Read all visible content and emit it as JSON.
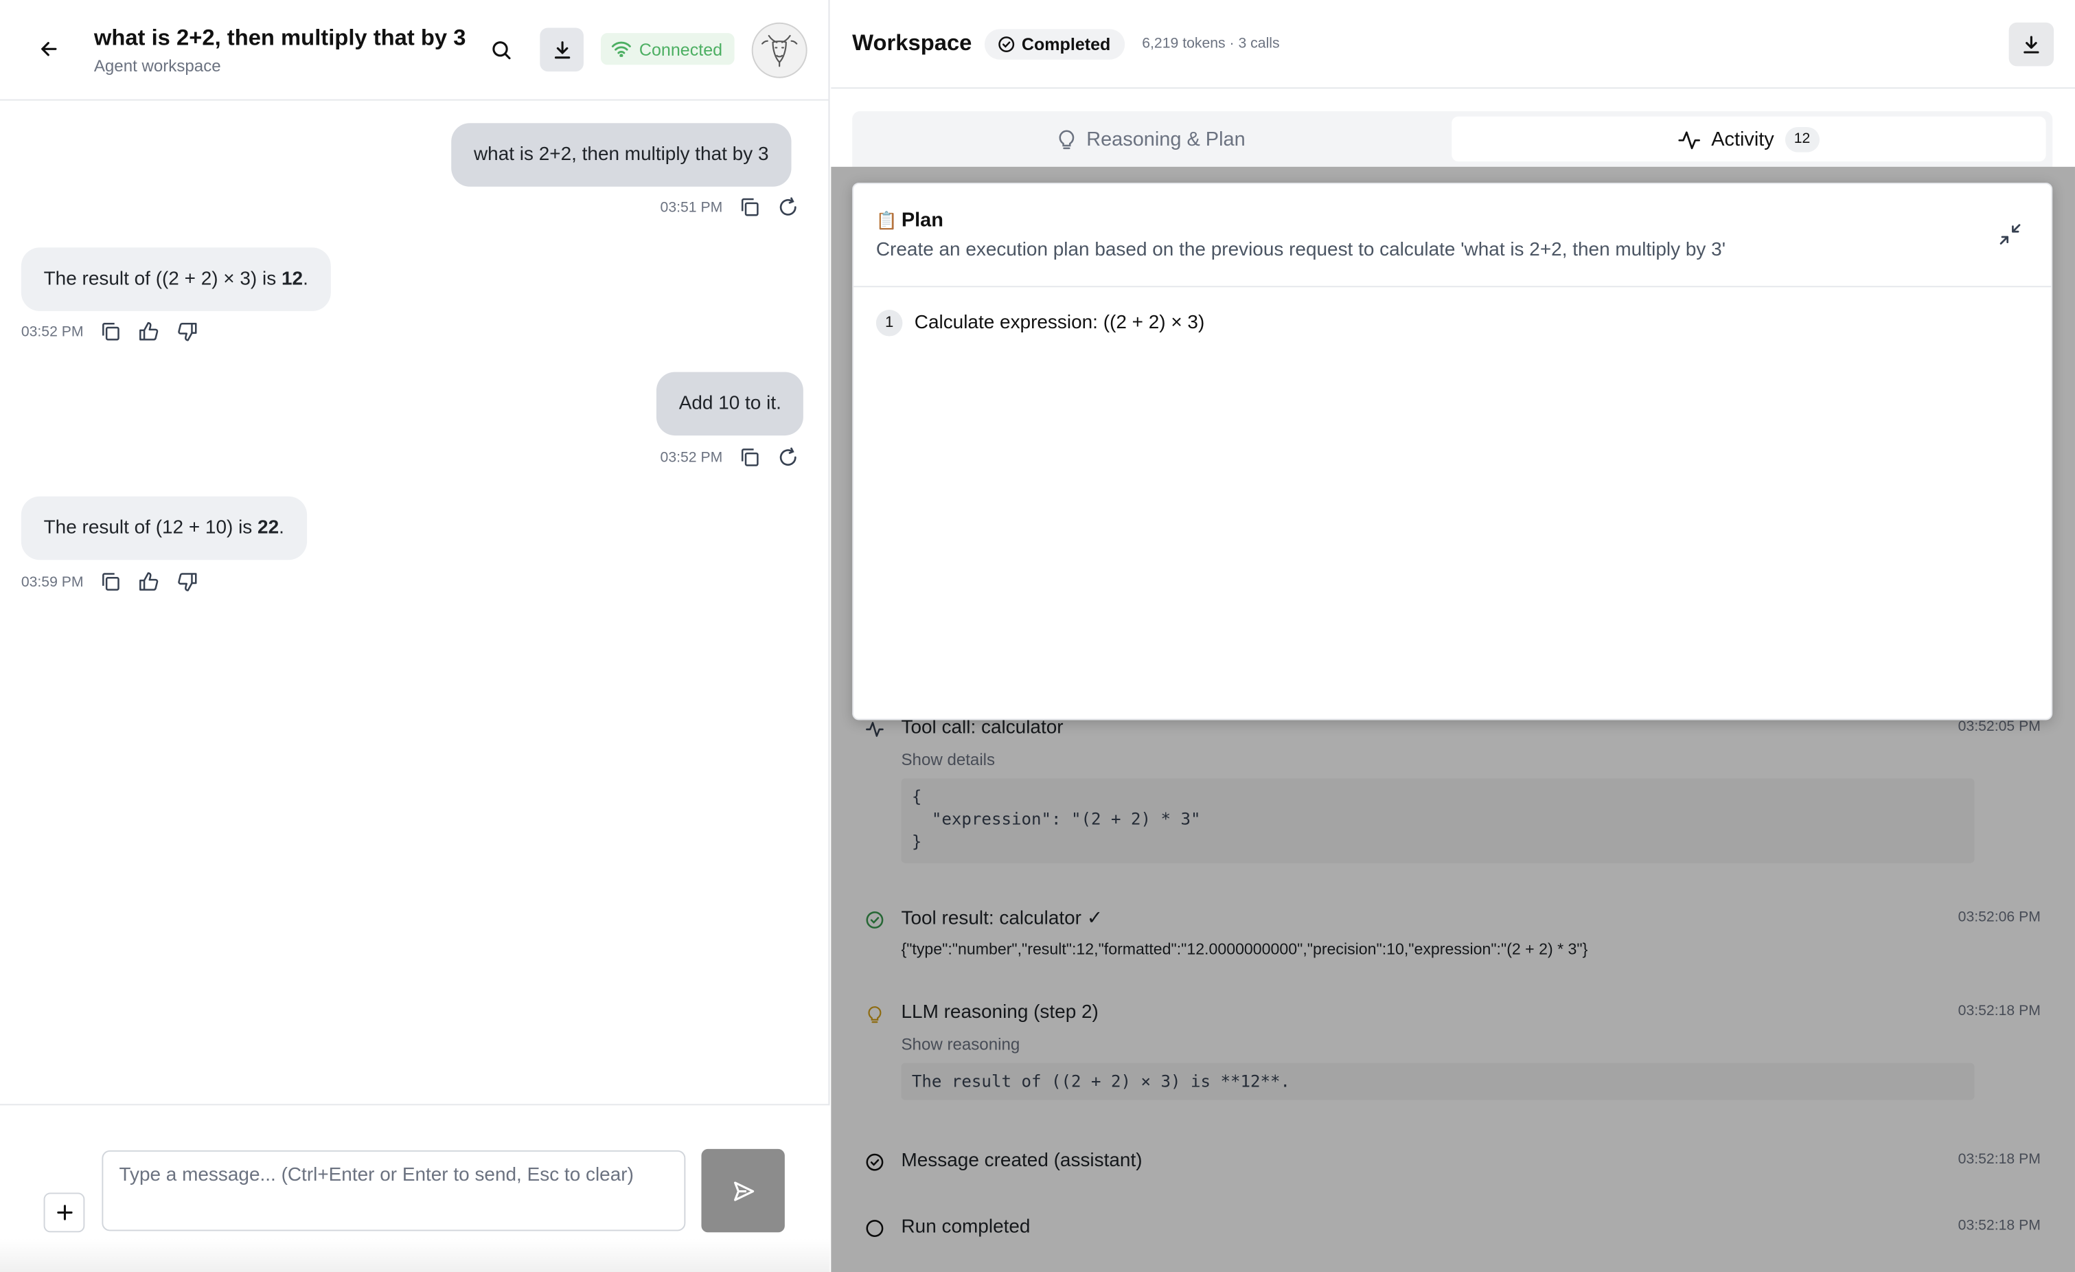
{
  "chat": {
    "title": "what is 2+2, then multiply that by 3",
    "subtitle": "Agent workspace",
    "connection_status": "Connected",
    "messages": [
      {
        "role": "user",
        "text": "what is 2+2, then multiply that by 3",
        "time": "03:51 PM"
      },
      {
        "role": "assistant",
        "prefix": "The result of ((2 + 2) × 3) is ",
        "bold": "12",
        "suffix": ".",
        "time": "03:52 PM"
      },
      {
        "role": "user",
        "text": "Add 10 to it.",
        "time": "03:52 PM"
      },
      {
        "role": "assistant",
        "prefix": "The result of (12 + 10) is ",
        "bold": "22",
        "suffix": ".",
        "time": "03:59 PM"
      }
    ],
    "composer": {
      "placeholder": "Type a message... (Ctrl+Enter or Enter to send, Esc to clear)"
    }
  },
  "workspace": {
    "title": "Workspace",
    "status": "Completed",
    "stats": "6,219 tokens · 3 calls",
    "tabs": [
      {
        "label": "Reasoning & Plan",
        "icon": "lightbulb-icon",
        "active": false
      },
      {
        "label": "Activity",
        "icon": "activity-icon",
        "active": true,
        "count": "12"
      }
    ],
    "activity": [
      {
        "icon": "activity-icon",
        "title": "Tool call: calculator",
        "time": "03:52:05 PM",
        "link": "Show details",
        "code": "{\n  \"expression\": \"(2 + 2) * 3\"\n}"
      },
      {
        "icon": "check-circle-icon",
        "title": "Tool result: calculator ✓",
        "time": "03:52:06 PM",
        "json": "{\"type\":\"number\",\"result\":12,\"formatted\":\"12.0000000000\",\"precision\":10,\"expression\":\"(2 + 2) * 3\"}"
      },
      {
        "icon": "lightbulb-icon",
        "title": "LLM reasoning (step 2)",
        "time": "03:52:18 PM",
        "link": "Show reasoning",
        "code": "The result of ((2 + 2) × 3) is **12**."
      },
      {
        "icon": "check-circle-icon",
        "title": "Message created (assistant)",
        "time": "03:52:18 PM"
      },
      {
        "icon": "circle-icon",
        "title": "Run completed",
        "time": "03:52:18 PM"
      }
    ],
    "plan": {
      "emoji": "📋",
      "title": "Plan",
      "description": "Create an execution plan based on the previous request to calculate 'what is 2+2, then multiply by 3'",
      "steps": [
        {
          "num": "1",
          "text": "Calculate expression: ((2 + 2) × 3)"
        }
      ]
    }
  },
  "colors": {
    "connected_green": "#4caf62",
    "user_bubble": "#d7dae0",
    "assistant_bubble": "#eef0f3",
    "send_button": "#8c8c8c",
    "reasoning_amber": "#d4a017"
  }
}
